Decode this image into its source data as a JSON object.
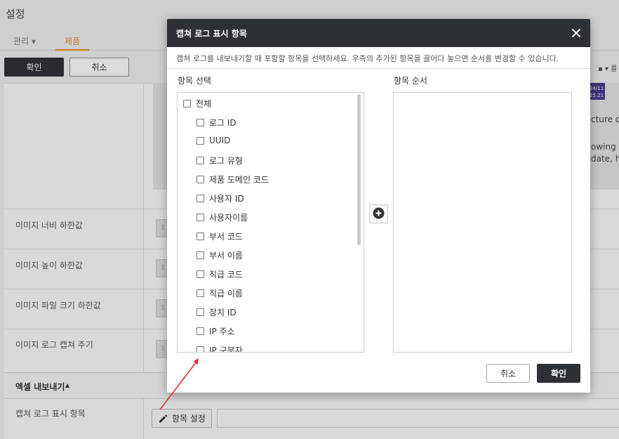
{
  "page": {
    "title": "설정",
    "tabs": [
      {
        "label": "관리 ▾"
      },
      {
        "label": "제품"
      }
    ],
    "toolbar": {
      "confirm_label": "확인",
      "cancel_label": "취소",
      "top_right_control": "▪ ▾ 를"
    },
    "preview": {
      "badge_line1": "24/11",
      "badge_line2": "25.21",
      "text_lines": [
        "cture of",
        "owing a",
        "date, he"
      ]
    },
    "rows": [
      {
        "label": "이미지 너비 하한값"
      },
      {
        "label": "이미지 높이 하한값"
      },
      {
        "label": "이미지 파일 크기 하한값"
      },
      {
        "label": "이미지 로그 캡쳐 주기"
      }
    ],
    "row_input_glyph": "1",
    "excel_section": {
      "title": "엑셀 내보내기",
      "caret": "▲",
      "capture_label": "캡쳐 로그 표시 항목",
      "item_setting_button": "항목 설정"
    }
  },
  "modal": {
    "title": "캡쳐 로그 표시 항목",
    "description": "캡쳐 로그를 내보내기할 때 포함할 항목을 선택하세요. 우측의 추가된 항목을 끌어다 놓으면 순서를 변경할 수 있습니다.",
    "left_column_title": "항목 선택",
    "right_column_title": "항목 순서",
    "all_item": "전체",
    "items": [
      "로그 ID",
      "UUID",
      "로그 유형",
      "제품 도메인 코드",
      "사용자 ID",
      "사용자이름",
      "부서 코드",
      "부서 이름",
      "직급 코드",
      "직급 이름",
      "장치 ID",
      "IP 주소",
      "IP 구분자"
    ],
    "cancel_label": "취소",
    "ok_label": "확인"
  },
  "colors": {
    "header_dark": "#2d3136",
    "accent_orange": "#e48a1c",
    "annotation_arrow": "#e03030"
  }
}
